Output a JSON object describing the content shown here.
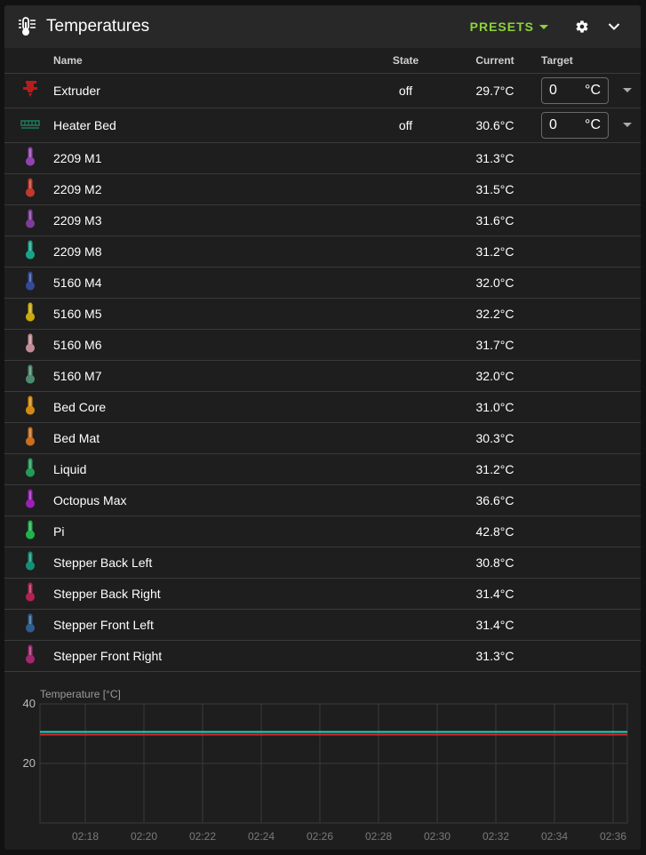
{
  "header": {
    "title": "Temperatures",
    "presets_label": "PRESETS"
  },
  "columns": {
    "name": "Name",
    "state": "State",
    "current": "Current",
    "target": "Target"
  },
  "heaters": [
    {
      "name": "Extruder",
      "state": "off",
      "current": "29.7°C",
      "target": "0",
      "unit": "°C",
      "color": "#b71c1c",
      "icon": "extruder-icon"
    },
    {
      "name": "Heater Bed",
      "state": "off",
      "current": "30.6°C",
      "target": "0",
      "unit": "°C",
      "color": "#1b7a5a",
      "icon": "heater-bed-icon"
    }
  ],
  "sensors": [
    {
      "name": "2209 M1",
      "current": "31.3°C",
      "color": "#8e44ad"
    },
    {
      "name": "2209 M2",
      "current": "31.5°C",
      "color": "#c0392b"
    },
    {
      "name": "2209 M3",
      "current": "31.6°C",
      "color": "#7d3c98"
    },
    {
      "name": "2209 M8",
      "current": "31.2°C",
      "color": "#17a589"
    },
    {
      "name": "5160 M4",
      "current": "32.0°C",
      "color": "#34499a"
    },
    {
      "name": "5160 M5",
      "current": "32.2°C",
      "color": "#c9a90d"
    },
    {
      "name": "5160 M6",
      "current": "31.7°C",
      "color": "#c08b96"
    },
    {
      "name": "5160 M7",
      "current": "32.0°C",
      "color": "#4d8a6e"
    },
    {
      "name": "Bed Core",
      "current": "31.0°C",
      "color": "#d68910"
    },
    {
      "name": "Bed Mat",
      "current": "30.3°C",
      "color": "#ca6f1e"
    },
    {
      "name": "Liquid",
      "current": "31.2°C",
      "color": "#239b56"
    },
    {
      "name": "Octopus Max",
      "current": "36.6°C",
      "color": "#9c1fb5"
    },
    {
      "name": "Pi",
      "current": "42.8°C",
      "color": "#1fb34b"
    },
    {
      "name": "Stepper Back Left",
      "current": "30.8°C",
      "color": "#148f77"
    },
    {
      "name": "Stepper Back Right",
      "current": "31.4°C",
      "color": "#b0234f"
    },
    {
      "name": "Stepper Front Left",
      "current": "31.4°C",
      "color": "#2e5d8e"
    },
    {
      "name": "Stepper Front Right",
      "current": "31.3°C",
      "color": "#a0286e"
    }
  ],
  "chart_data": {
    "type": "line",
    "ylabel": "Temperature [°C]",
    "ylim": [
      0,
      40
    ],
    "yticks": [
      20,
      40
    ],
    "xticks": [
      "02:18",
      "02:20",
      "02:22",
      "02:24",
      "02:26",
      "02:28",
      "02:30",
      "02:32",
      "02:34",
      "02:36"
    ],
    "grid": true,
    "series": [
      {
        "color": "#1fd4c4",
        "values": [
          30.6,
          30.6
        ]
      },
      {
        "color": "#d42a2a",
        "values": [
          29.7,
          29.7
        ]
      }
    ]
  }
}
